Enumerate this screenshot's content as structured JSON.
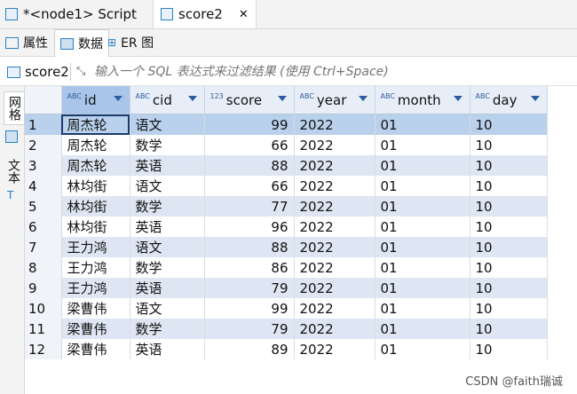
{
  "tabs": [
    {
      "label": "*<node1> Script"
    },
    {
      "label": "score2"
    }
  ],
  "subtabs": [
    {
      "label": "属性"
    },
    {
      "label": "数据"
    },
    {
      "label": "ER 图"
    }
  ],
  "filter": {
    "table_name": "score2",
    "placeholder": "输入一个 SQL 表达式来过滤结果 (使用 Ctrl+Space)"
  },
  "side_tabs": [
    "网格",
    "文本"
  ],
  "grid": {
    "columns": [
      {
        "type": "ABC",
        "name": "id"
      },
      {
        "type": "ABC",
        "name": "cid"
      },
      {
        "type": "123",
        "name": "score"
      },
      {
        "type": "ABC",
        "name": "year"
      },
      {
        "type": "ABC",
        "name": "month"
      },
      {
        "type": "ABC",
        "name": "day"
      }
    ],
    "rows": [
      [
        "1",
        "周杰轮",
        "语文",
        "99",
        "2022",
        "01",
        "10"
      ],
      [
        "2",
        "周杰轮",
        "数学",
        "66",
        "2022",
        "01",
        "10"
      ],
      [
        "3",
        "周杰轮",
        "英语",
        "88",
        "2022",
        "01",
        "10"
      ],
      [
        "4",
        "林均街",
        "语文",
        "66",
        "2022",
        "01",
        "10"
      ],
      [
        "5",
        "林均街",
        "数学",
        "77",
        "2022",
        "01",
        "10"
      ],
      [
        "6",
        "林均街",
        "英语",
        "96",
        "2022",
        "01",
        "10"
      ],
      [
        "7",
        "王力鸿",
        "语文",
        "88",
        "2022",
        "01",
        "10"
      ],
      [
        "8",
        "王力鸿",
        "数学",
        "86",
        "2022",
        "01",
        "10"
      ],
      [
        "9",
        "王力鸿",
        "英语",
        "79",
        "2022",
        "01",
        "10"
      ],
      [
        "10",
        "梁曹伟",
        "语文",
        "99",
        "2022",
        "01",
        "10"
      ],
      [
        "11",
        "梁曹伟",
        "数学",
        "79",
        "2022",
        "01",
        "10"
      ],
      [
        "12",
        "梁曹伟",
        "英语",
        "89",
        "2022",
        "01",
        "10"
      ]
    ]
  },
  "watermark": "CSDN @faith瑞诚",
  "colors": {
    "accent": "#2b7fc1",
    "selected_row": "#b9d1ec",
    "striped_row": "#dde6f2"
  }
}
